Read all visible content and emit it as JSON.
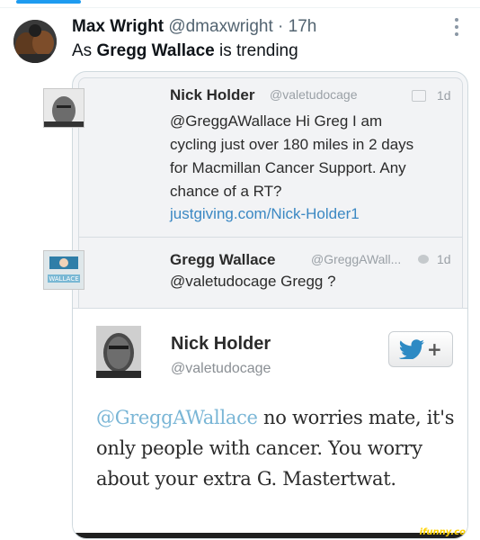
{
  "post": {
    "author": "Max Wright",
    "handle": "@dmaxwright",
    "separator": "·",
    "time": "17h",
    "text_before": "As ",
    "text_bold": "Gregg Wallace",
    "text_after": " is trending"
  },
  "screenshot": {
    "first_tweet": {
      "name": "Nick Holder",
      "handle": "@valetudocage",
      "time": "1d",
      "text": "@GreggAWallace Hi Greg I am cycling just over 180 miles in 2 days for Macmillan Cancer Support.  Any chance of a RT?",
      "link": "justgiving.com/Nick-Holder1"
    },
    "reply_tweet": {
      "name": "Gregg Wallace",
      "handle": "@GreggAWall...",
      "time": "1d",
      "text": "@valetudocage Gregg ?",
      "avatar_caption": "WALLACE"
    },
    "expanded_tweet": {
      "name": "Nick Holder",
      "handle": "@valetudocage",
      "follow_plus": "+",
      "mention": "@GreggAWallace",
      "text": " no worries mate, it's only people with cancer. You worry about your extra G. Mastertwat."
    },
    "watermark": "ifunny.co"
  },
  "colors": {
    "accent": "#1d9bf0",
    "link": "#3b88c3",
    "mention": "#7ab6d6",
    "secondary_text": "#536471"
  },
  "icons": [
    "more-options-icon",
    "compose-icon",
    "reply-bubble-icon",
    "twitter-bird-icon"
  ]
}
